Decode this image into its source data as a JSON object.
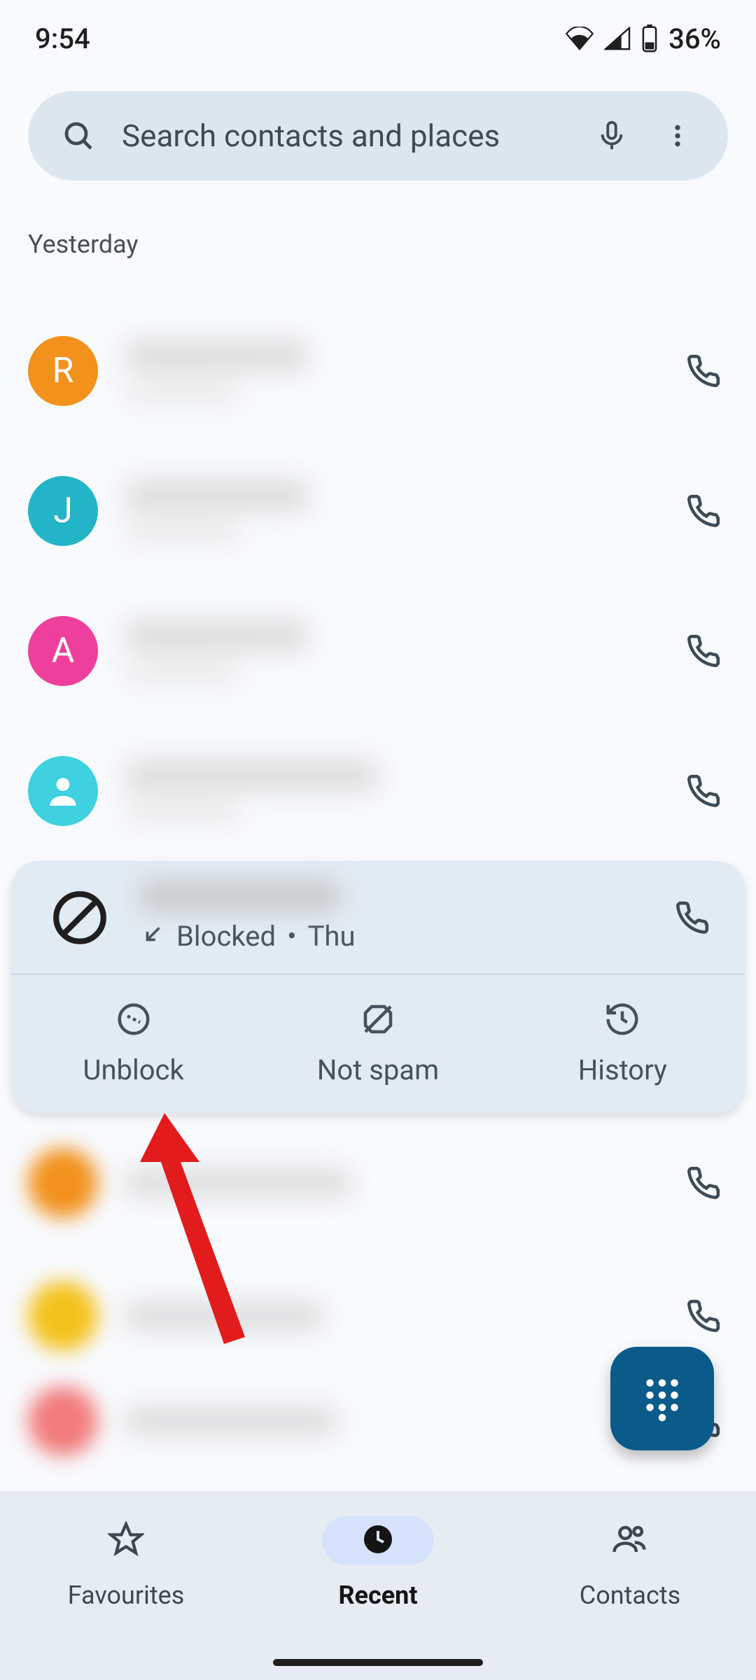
{
  "status": {
    "time": "9:54",
    "battery_text": "36%"
  },
  "search": {
    "placeholder": "Search contacts and places"
  },
  "section_label": "Yesterday",
  "calls": [
    {
      "avatar_letter": "R",
      "avatar_color": "#f2911b"
    },
    {
      "avatar_letter": "J",
      "avatar_color": "#24b4c8"
    },
    {
      "avatar_letter": "A",
      "avatar_color": "#ef3f9c"
    },
    {
      "avatar_letter": "",
      "avatar_color": "#3fd1df",
      "is_generic": true
    }
  ],
  "blocked": {
    "sub_status": "Blocked",
    "sep": "•",
    "day": "Thu",
    "actions": {
      "unblock": "Unblock",
      "not_spam": "Not spam",
      "history": "History"
    }
  },
  "bottom_nav": {
    "favourites": "Favourites",
    "recent": "Recent",
    "contacts": "Contacts"
  }
}
